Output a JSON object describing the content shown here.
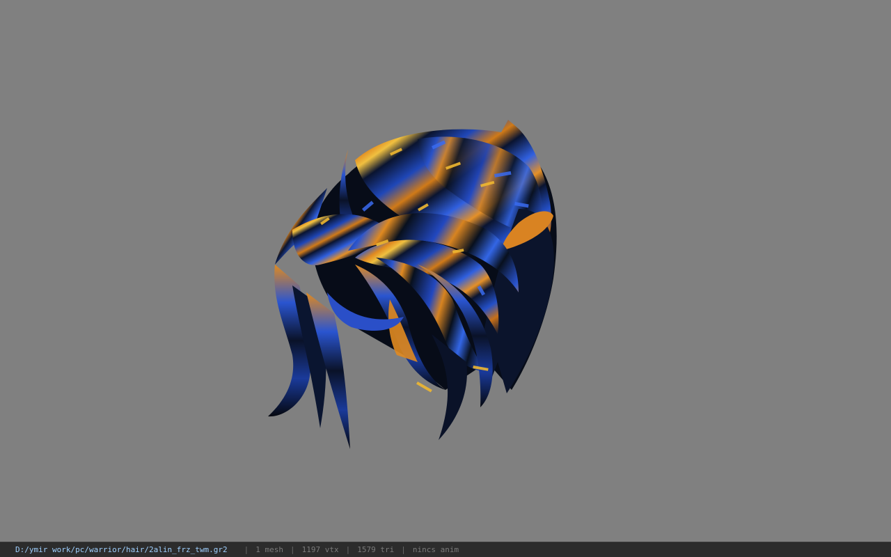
{
  "viewer": {
    "background_color": "#808080",
    "model_icon": "hair-mesh",
    "colors": {
      "blue": "#2a5bd6",
      "orange": "#e08a20",
      "dark": "#08101e"
    }
  },
  "statusbar": {
    "file_path": "D:/ymir work/pc/warrior/hair/2alin_frz_twm.gr2",
    "separator": "|",
    "mesh_count": "1 mesh",
    "vertex_count": "1197 vtx",
    "triangle_count": "1579 tri",
    "animation": "nincs anim"
  }
}
